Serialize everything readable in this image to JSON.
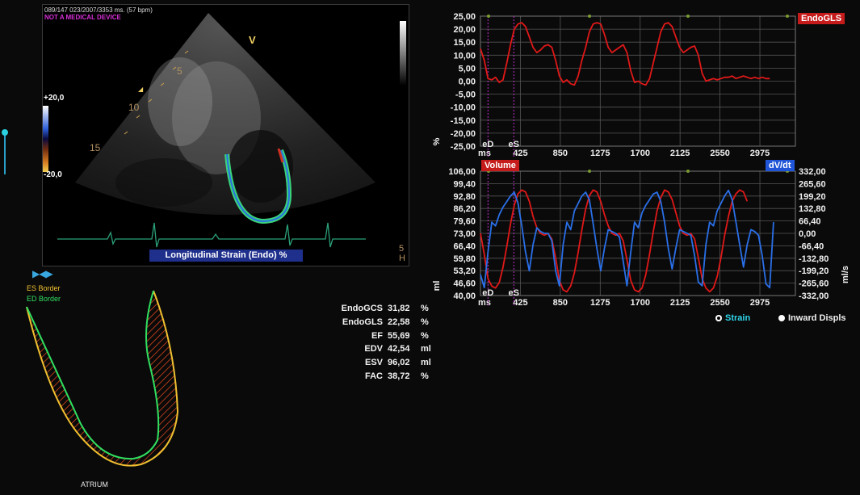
{
  "echo": {
    "header": "089/147  023/2007/3353 ms.  (57 bpm)",
    "warning": "NOT A MEDICAL DEVICE",
    "scale_top": "+20,0",
    "scale_bottom": "-20,0",
    "orientation_mark": "V",
    "depth_labels": [
      "5",
      "10",
      "15"
    ],
    "corner_labels": [
      "5",
      "H"
    ],
    "strain_mode_label": "Longitudinal Strain (Endo) %"
  },
  "controls": {
    "player_buttons": "▶|◀◀ ▶|"
  },
  "borders_legend": {
    "es_label": "ES Border",
    "ed_label": "ED Border",
    "chamber_label": "ATRIUM"
  },
  "metrics": [
    {
      "label": "EndoGCS",
      "value": "31,82",
      "unit": "%"
    },
    {
      "label": "EndoGLS",
      "value": "22,58",
      "unit": "%"
    },
    {
      "label": "EF",
      "value": "55,69",
      "unit": "%"
    },
    {
      "label": "EDV",
      "value": "42,54",
      "unit": "ml"
    },
    {
      "label": "ESV",
      "value": "96,02",
      "unit": "ml"
    },
    {
      "label": "FAC",
      "value": "38,72",
      "unit": "%"
    }
  ],
  "radio_options": [
    {
      "label": "Strain",
      "selected": true,
      "color": "#2fd6ea"
    },
    {
      "label": "Inward Displs",
      "selected": false,
      "color": "#f0f0f0"
    }
  ],
  "colors": {
    "strain_line": "#e01818",
    "volume_line": "#e01818",
    "dvdt_line": "#2a6fe8",
    "event_marker": "#c02ccc",
    "ecg": "#2aa07a",
    "es_border": "#f0c030",
    "ed_border": "#30e060"
  },
  "chart_data": [
    {
      "type": "line",
      "title": "EndoGLS",
      "ylabel": "%",
      "xlabel": "ms",
      "ylim": [
        -25,
        25
      ],
      "yticks": [
        "25,00",
        "20,00",
        "15,00",
        "10,00",
        "5,00",
        "0,00",
        "-5,00",
        "-10,00",
        "-15,00",
        "-20,00",
        "-25,00"
      ],
      "xticks": [
        "ms",
        "425",
        "850",
        "1275",
        "1700",
        "2125",
        "2550",
        "2975"
      ],
      "xlim": [
        0,
        3353
      ],
      "event_markers": [
        {
          "label": "eD",
          "x": 80
        },
        {
          "label": "eS",
          "x": 355
        }
      ],
      "series": [
        {
          "name": "EndoGLS",
          "x": [
            0,
            40,
            80,
            120,
            160,
            200,
            240,
            280,
            320,
            360,
            400,
            440,
            480,
            520,
            560,
            600,
            640,
            680,
            720,
            760,
            800,
            840,
            880,
            920,
            960,
            1000,
            1040,
            1080,
            1120,
            1160,
            1200,
            1240,
            1280,
            1320,
            1360,
            1400,
            1440,
            1480,
            1520,
            1560,
            1600,
            1640,
            1680,
            1720,
            1760,
            1800,
            1840,
            1880,
            1920,
            1960,
            2000,
            2040,
            2080,
            2120,
            2160,
            2200,
            2240,
            2280,
            2320,
            2360,
            2400,
            2440,
            2480,
            2520,
            2560,
            2600,
            2640,
            2680,
            2720,
            2760,
            2800,
            2840,
            2880,
            2920,
            2960,
            3000,
            3040,
            3080
          ],
          "y": [
            12.5,
            8,
            1,
            0.5,
            1.5,
            -0.5,
            0.5,
            7,
            14,
            20,
            22,
            22.5,
            21,
            17,
            13,
            11,
            12,
            13.5,
            14,
            13,
            8,
            2,
            -0.5,
            0.5,
            -1,
            -1.5,
            2,
            8,
            13,
            19,
            22,
            22.5,
            22,
            18,
            13,
            11,
            12,
            13,
            14,
            11,
            4,
            -0.5,
            0,
            -1,
            -1.5,
            1,
            7,
            13,
            19,
            22,
            22.5,
            21,
            17,
            13,
            11,
            12,
            13,
            13.5,
            10,
            3,
            0,
            0.5,
            1,
            0.5,
            1,
            1.5,
            1.5,
            2,
            1,
            1.5,
            2,
            1.5,
            1,
            1.5,
            1,
            1.5,
            1,
            1
          ]
        }
      ]
    },
    {
      "type": "line",
      "title": "Volume",
      "ylabel": "ml",
      "y2label": "ml/s",
      "xlabel": "ms",
      "ylim": [
        40,
        106
      ],
      "y2lim": [
        -332,
        332
      ],
      "yticks": [
        "106,00",
        "99,40",
        "92,80",
        "86,20",
        "79,60",
        "73,00",
        "66,40",
        "59,80",
        "53,20",
        "46,60",
        "40,00"
      ],
      "y2ticks": [
        "332,00",
        "265,60",
        "199,20",
        "132,80",
        "66,40",
        "0,00",
        "-66,40",
        "-132,80",
        "-199,20",
        "-265,60",
        "-332,00"
      ],
      "xticks": [
        "ms",
        "425",
        "850",
        "1275",
        "1700",
        "2125",
        "2550",
        "2975"
      ],
      "xlim": [
        0,
        3353
      ],
      "event_markers": [
        {
          "label": "eD",
          "x": 80
        },
        {
          "label": "eS",
          "x": 355
        }
      ],
      "series": [
        {
          "name": "Volume",
          "x": [
            0,
            40,
            80,
            120,
            160,
            200,
            240,
            280,
            320,
            360,
            400,
            440,
            480,
            520,
            560,
            600,
            640,
            680,
            720,
            760,
            800,
            840,
            880,
            920,
            960,
            1000,
            1040,
            1080,
            1120,
            1160,
            1200,
            1240,
            1280,
            1320,
            1360,
            1400,
            1440,
            1480,
            1520,
            1560,
            1600,
            1640,
            1680,
            1720,
            1760,
            1800,
            1840,
            1880,
            1920,
            1960,
            2000,
            2040,
            2080,
            2120,
            2160,
            2200,
            2240,
            2280,
            2320,
            2360,
            2400,
            2440,
            2480,
            2520,
            2560,
            2600,
            2640,
            2680,
            2720,
            2760,
            2800,
            2840
          ],
          "y": [
            73,
            62,
            49,
            45,
            44,
            47,
            55,
            66,
            78,
            88,
            94,
            96,
            95,
            90,
            82,
            76,
            73,
            72,
            73,
            70,
            60,
            48,
            43,
            42,
            45,
            52,
            63,
            75,
            86,
            93,
            96,
            95,
            90,
            83,
            77,
            73,
            72,
            73,
            69,
            59,
            48,
            43,
            42,
            44,
            51,
            62,
            74,
            85,
            92,
            96,
            95,
            91,
            84,
            77,
            73,
            72,
            73,
            70,
            60,
            49,
            44,
            42,
            44,
            50,
            60,
            72,
            82,
            90,
            94,
            96,
            95,
            90
          ]
        },
        {
          "name": "dV/dt",
          "y_axis": "right",
          "x": [
            0,
            40,
            80,
            120,
            160,
            200,
            240,
            280,
            320,
            360,
            400,
            440,
            480,
            520,
            560,
            600,
            640,
            680,
            720,
            760,
            800,
            840,
            880,
            920,
            960,
            1000,
            1040,
            1080,
            1120,
            1160,
            1200,
            1240,
            1280,
            1320,
            1360,
            1400,
            1440,
            1480,
            1520,
            1560,
            1600,
            1640,
            1680,
            1720,
            1760,
            1800,
            1840,
            1880,
            1920,
            1960,
            2000,
            2040,
            2080,
            2120,
            2160,
            2200,
            2240,
            2280,
            2320,
            2360,
            2400,
            2440,
            2480,
            2520,
            2560,
            2600,
            2640,
            2680,
            2720,
            2760,
            2800,
            2840,
            2880,
            2920,
            2960,
            3000,
            3040,
            3080,
            3120
          ],
          "y": [
            -220,
            -290,
            -100,
            60,
            40,
            100,
            140,
            170,
            200,
            220,
            160,
            40,
            -100,
            -200,
            -60,
            30,
            10,
            0,
            0,
            -40,
            -200,
            -280,
            -60,
            60,
            20,
            120,
            160,
            200,
            220,
            180,
            50,
            -80,
            -200,
            -80,
            20,
            10,
            0,
            -20,
            -150,
            -280,
            -100,
            60,
            30,
            110,
            150,
            180,
            210,
            220,
            170,
            60,
            -80,
            -190,
            -80,
            20,
            10,
            0,
            -10,
            -120,
            -260,
            -280,
            -60,
            60,
            40,
            120,
            160,
            200,
            230,
            180,
            60,
            -60,
            -180,
            -60,
            20,
            10,
            -10,
            -120,
            -270,
            -290,
            60
          ]
        }
      ]
    }
  ]
}
